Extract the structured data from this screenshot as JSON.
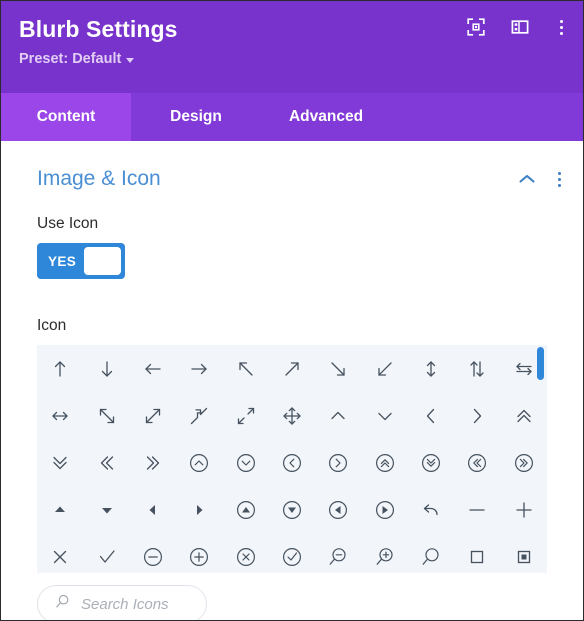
{
  "header": {
    "title": "Blurb Settings",
    "preset_label": "Preset: Default",
    "actions": [
      {
        "name": "focus-icon",
        "label": "Focus"
      },
      {
        "name": "layout-icon",
        "label": "Layout"
      },
      {
        "name": "more-options-icon",
        "label": "More options"
      }
    ],
    "background_color": "#7733cc"
  },
  "tabs": {
    "items": [
      {
        "label": "Content",
        "active": true
      },
      {
        "label": "Design",
        "active": false
      },
      {
        "label": "Advanced",
        "active": false
      }
    ],
    "bar_color": "#8139d8",
    "active_color": "#9a46e8"
  },
  "section": {
    "title": "Image & Icon",
    "title_color": "#4a8fd4",
    "collapse_icon": "chevron-up-icon",
    "options_icon": "more-options-icon"
  },
  "use_icon_field": {
    "label": "Use Icon",
    "toggle_value": "YES",
    "toggle_on": true,
    "toggle_color": "#2e87d8"
  },
  "icon_field": {
    "label": "Icon",
    "grid_background": "#f2f5f9",
    "scrollbar_color": "#2e87d8",
    "icons": [
      "arrow-up",
      "arrow-down",
      "arrow-left",
      "arrow-right",
      "arrow-up-left",
      "arrow-up-right",
      "arrow-down-right",
      "arrow-down-left",
      "arrow-up-down",
      "arrows-up-down",
      "arrow-left-right-double",
      "arrow-left-right",
      "arrow-diagonal-nw-se",
      "arrow-diagonal-sw-ne",
      "arrows-contract",
      "arrows-expand",
      "arrows-move",
      "chevron-up",
      "chevron-down",
      "chevron-left",
      "chevron-right",
      "chevron-double-up",
      "chevron-double-down",
      "chevron-double-left",
      "chevron-double-right",
      "circle-chevron-up",
      "circle-chevron-down",
      "circle-chevron-left",
      "circle-chevron-right",
      "circle-chevron-double-up",
      "circle-chevron-double-down",
      "circle-chevron-double-left",
      "circle-chevron-double-right",
      "triangle-up",
      "triangle-down",
      "triangle-left",
      "triangle-right",
      "circle-triangle-up",
      "circle-triangle-down",
      "circle-triangle-left",
      "circle-triangle-right",
      "undo-arrow",
      "minus",
      "plus",
      "close-x",
      "check",
      "circle-minus",
      "circle-plus",
      "circle-x",
      "circle-check",
      "zoom-out",
      "zoom-in",
      "search",
      "square-outline",
      "square-filled"
    ]
  },
  "search": {
    "placeholder": "Search Icons",
    "icon": "search-icon",
    "value": ""
  }
}
